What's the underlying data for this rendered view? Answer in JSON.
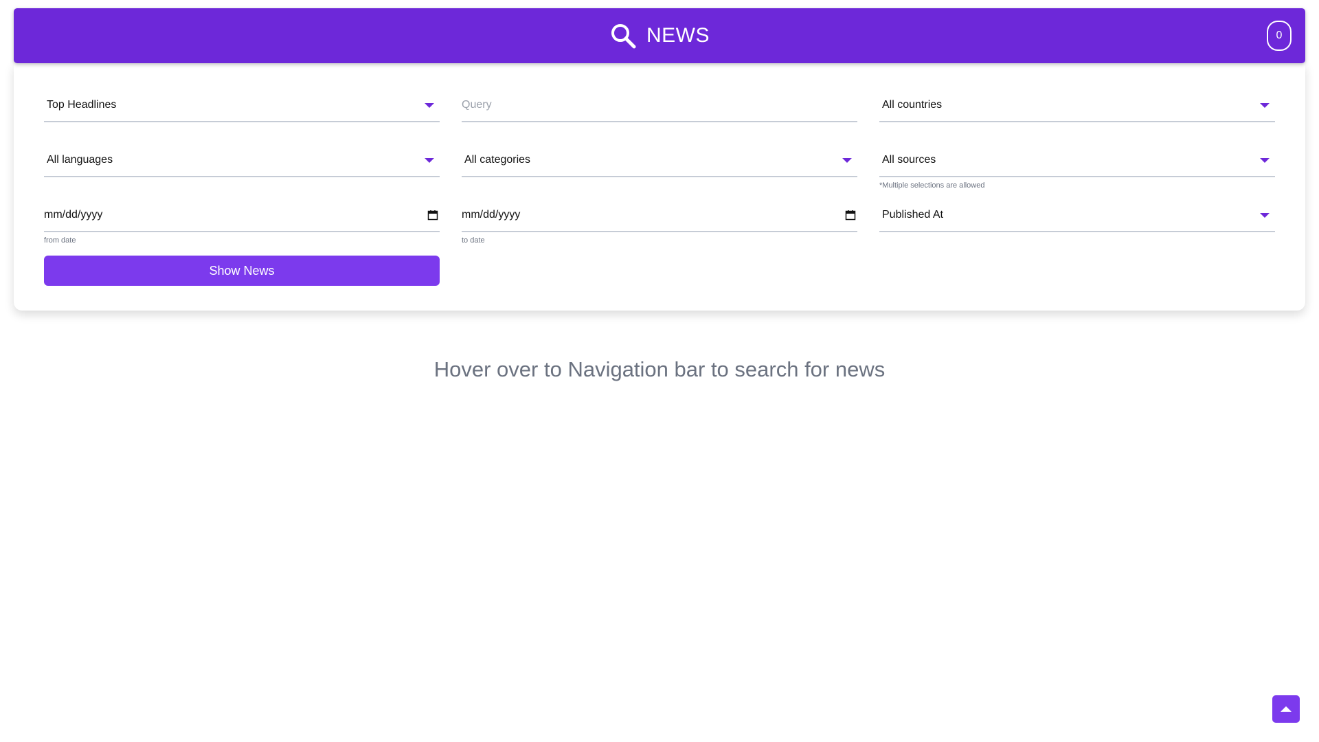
{
  "header": {
    "title": "NEWS",
    "icon": "search-icon",
    "badge_count": "0",
    "background_color": "#6d28d9"
  },
  "filters": {
    "headline_type": {
      "selected": "Top Headlines"
    },
    "query": {
      "value": "",
      "placeholder": "Query"
    },
    "country": {
      "selected": "All countries"
    },
    "language": {
      "selected": "All languages"
    },
    "category": {
      "selected": "All categories"
    },
    "sources": {
      "selected": "All sources",
      "helper": "*Multiple selections are allowed"
    },
    "from_date": {
      "value": "mm/dd/yyyy",
      "helper": "from date"
    },
    "to_date": {
      "value": "mm/dd/yyyy",
      "helper": "to date"
    },
    "sort_by": {
      "selected": "Published At"
    }
  },
  "actions": {
    "show_news_label": "Show News",
    "button_color": "#7c3aed"
  },
  "main": {
    "hint": "Hover over to Navigation bar to search for news"
  },
  "scroll_top": {
    "icon": "arrow-up-icon"
  }
}
